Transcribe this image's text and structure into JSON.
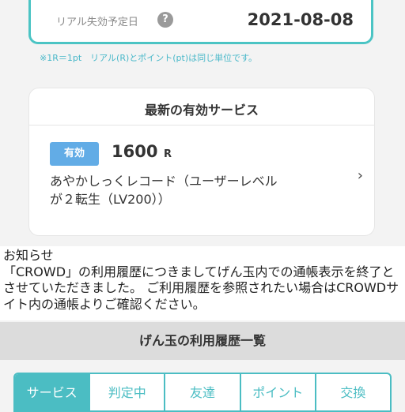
{
  "expiry": {
    "label": "リアル失効予定日",
    "help_icon": "?",
    "date": "2021-08-08",
    "note": "※1R＝1pt　リアル(R)とポイント(pt)は同じ単位です。"
  },
  "latest_service": {
    "title": "最新の有効サービス",
    "status_badge": "有効",
    "points": "1600",
    "points_unit": "R",
    "name": "あやかしっくレコード（ユーザーレベルが２転生（LV200））",
    "chevron": "›"
  },
  "notice": {
    "text": "お知らせ\n「CROWD」の利用履歴につきましてげん玉内での通帳表示を終了とさせていただきました。 ご利用履歴を参照されたい場合はCROWDサイト内の通帳よりご確認ください。"
  },
  "history": {
    "title": "げん玉の利用履歴一覧",
    "tabs": [
      {
        "label": "サービス",
        "active": true
      },
      {
        "label": "判定中",
        "active": false
      },
      {
        "label": "友達",
        "active": false
      },
      {
        "label": "ポイント",
        "active": false
      },
      {
        "label": "交換",
        "active": false
      }
    ]
  },
  "colors": {
    "accent": "#4bbdc3",
    "badge": "#62ace6",
    "note": "#49b8c9"
  }
}
